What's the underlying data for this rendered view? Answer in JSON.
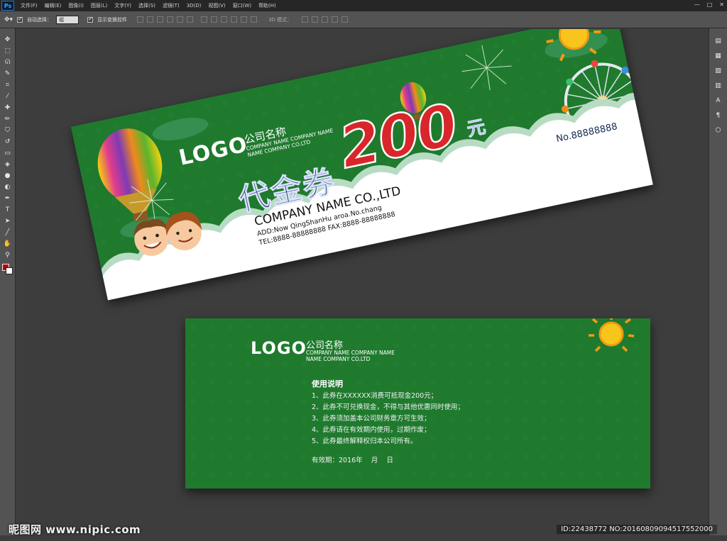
{
  "app": {
    "logo": "Ps",
    "menu": [
      "文件(F)",
      "编辑(E)",
      "图像(I)",
      "图层(L)",
      "文字(Y)",
      "选择(S)",
      "滤镜(T)",
      "3D(D)",
      "视图(V)",
      "窗口(W)",
      "帮助(H)"
    ],
    "window_controls": [
      "—",
      "□",
      "✕"
    ]
  },
  "options_bar": {
    "auto_select_label": "自动选择：",
    "auto_select_value": "组",
    "show_transform_label": "显示变换控件",
    "mode_3d_label": "3D 模式："
  },
  "left_tools": [
    {
      "icon": "move-icon",
      "glyph": "✥"
    },
    {
      "icon": "marquee-icon",
      "glyph": "⬚"
    },
    {
      "icon": "lasso-icon",
      "glyph": "ᘏ"
    },
    {
      "icon": "quick-select-icon",
      "glyph": "✎"
    },
    {
      "icon": "crop-icon",
      "glyph": "⌗"
    },
    {
      "icon": "eyedropper-icon",
      "glyph": "⁄"
    },
    {
      "icon": "healing-icon",
      "glyph": "✚"
    },
    {
      "icon": "brush-icon",
      "glyph": "✏"
    },
    {
      "icon": "stamp-icon",
      "glyph": "⛉"
    },
    {
      "icon": "history-brush-icon",
      "glyph": "↺"
    },
    {
      "icon": "eraser-icon",
      "glyph": "▭"
    },
    {
      "icon": "paint-bucket-icon",
      "glyph": "◈"
    },
    {
      "icon": "blur-icon",
      "glyph": "●"
    },
    {
      "icon": "dodge-icon",
      "glyph": "◐"
    },
    {
      "icon": "pen-icon",
      "glyph": "✒"
    },
    {
      "icon": "type-icon",
      "glyph": "T"
    },
    {
      "icon": "path-select-icon",
      "glyph": "➤"
    },
    {
      "icon": "line-icon",
      "glyph": "╱"
    },
    {
      "icon": "hand-icon",
      "glyph": "✋"
    },
    {
      "icon": "zoom-icon",
      "glyph": "⚲"
    }
  ],
  "right_panels": [
    {
      "icon": "history-panel-icon",
      "glyph": "▤"
    },
    {
      "icon": "layers-panel-icon",
      "glyph": "▦"
    },
    {
      "icon": "adjustments-panel-icon",
      "glyph": "▧"
    },
    {
      "icon": "channels-panel-icon",
      "glyph": "▥"
    },
    {
      "icon": "character-panel-icon",
      "glyph": "A"
    },
    {
      "icon": "paragraph-panel-icon",
      "glyph": "¶"
    },
    {
      "icon": "3d-panel-icon",
      "glyph": "⬡"
    }
  ],
  "colors": {
    "foreground": "#c00000",
    "background": "#ffffff",
    "ticket_green": "#1f7a2e",
    "amount_red": "#d8262a",
    "navy": "#10284f"
  },
  "front": {
    "logo": "LOGO",
    "company_cn": "公司名称",
    "company_en_1": "COMPANY NAME COMPANY NAME",
    "company_en_2": "NAME COMPANY CO.LTD",
    "title": "代金券",
    "amount": "200",
    "unit": "元",
    "ticket_no": "No.88888888",
    "company_name": "COMPANY NAME CO.,LTD",
    "address": "ADD:Now QingShanHu aroa.No.chang",
    "phones": "TEL:8888-88888888    FAX:8888-88888888"
  },
  "back": {
    "logo": "LOGO",
    "company_cn": "公司名称",
    "company_en_1": "COMPANY NAME COMPANY NAME",
    "company_en_2": "NAME COMPANY CO.LTD",
    "heading": "使用说明",
    "rules": [
      "1、此券在XXXXXX消费可抵现金200元；",
      "2、此券不可兑换现金，不得与其他优惠同时使用；",
      "3、此券须加盖本公司财务章方可生效；",
      "4、此券请在有效期内使用，过期作废；",
      "5、此券最终解释权归本公司所有。"
    ],
    "validity": "有效期：2016年    月    日"
  },
  "watermark": {
    "site": "昵图网 www.nipic.com",
    "id_line": "ID:22438772 NO:20160809094517552000"
  }
}
